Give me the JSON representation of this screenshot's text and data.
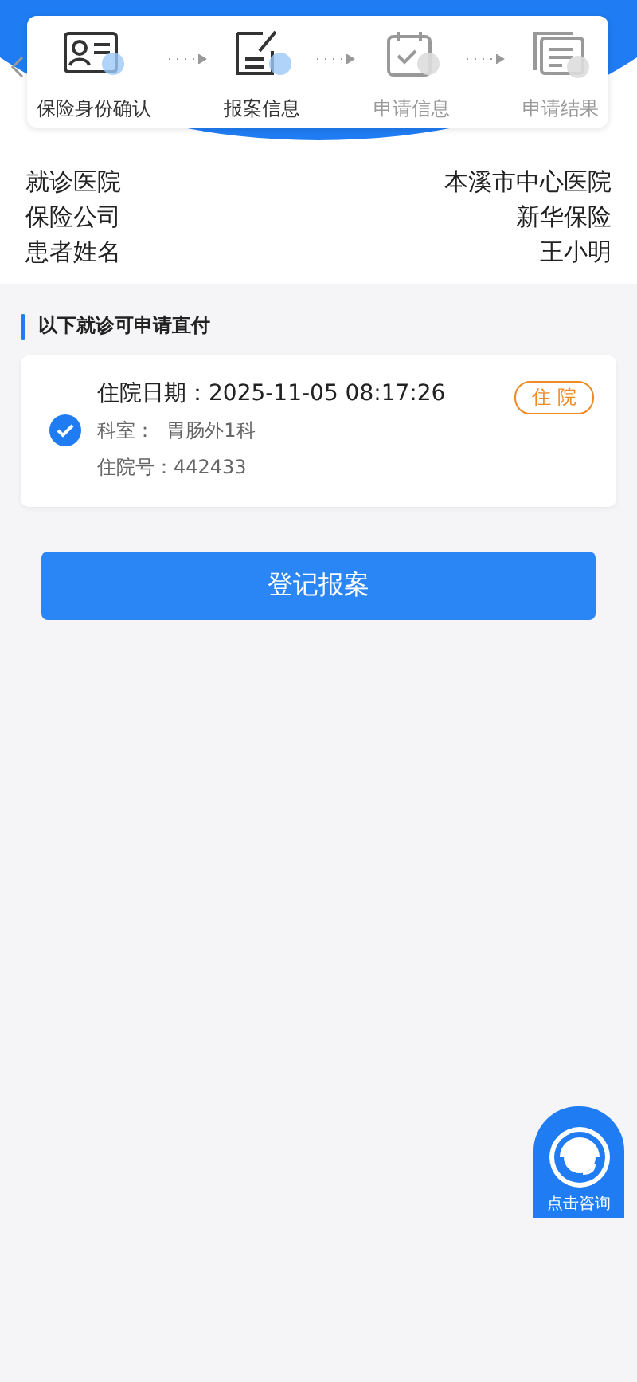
{
  "steps": [
    {
      "label": "保险身份确认",
      "active": true
    },
    {
      "label": "报案信息",
      "active": true
    },
    {
      "label": "申请信息",
      "active": false
    },
    {
      "label": "申请结果",
      "active": false
    }
  ],
  "info": [
    {
      "label": "就诊医院",
      "value": "本溪市中心医院"
    },
    {
      "label": "保险公司",
      "value": "新华保险"
    },
    {
      "label": "患者姓名",
      "value": "王小明"
    }
  ],
  "section_title": "以下就诊可申请直付",
  "visits": [
    {
      "checked": true,
      "title": "住院日期：2025-11-05 08:17:26",
      "tag": "住 院",
      "department": "科室：  胃肠外1科",
      "number": "住院号：442433"
    }
  ],
  "submit_button": "登记报案",
  "consult_button": "点击咨询"
}
